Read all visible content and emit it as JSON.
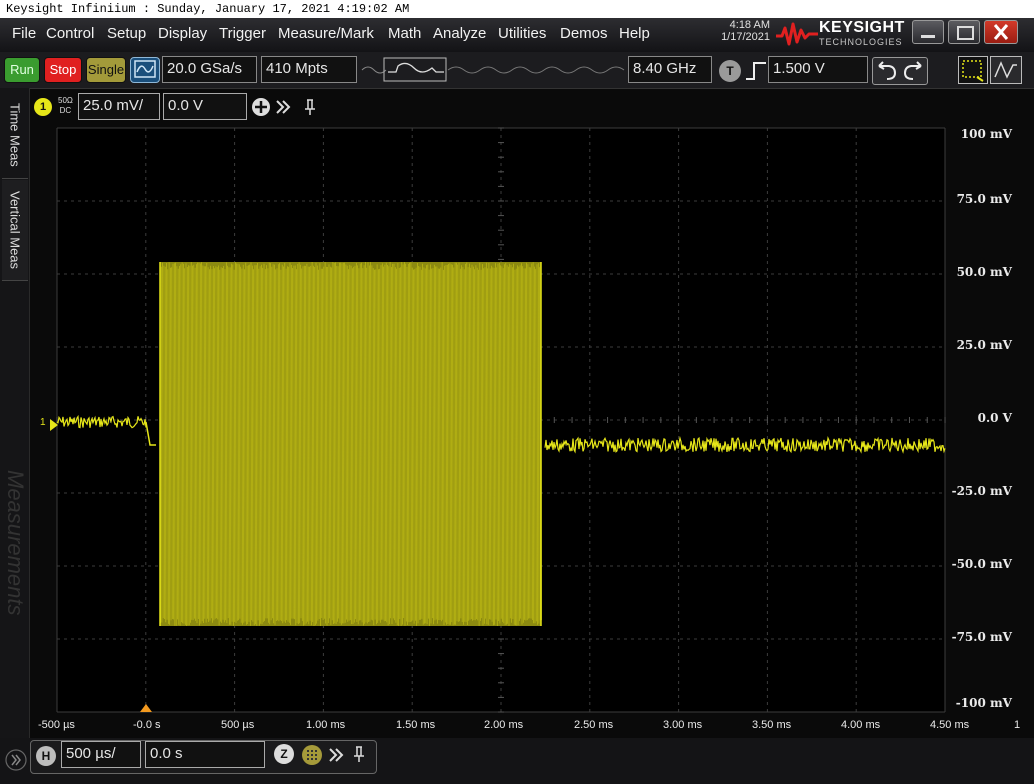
{
  "window": {
    "title": "Keysight Infiniium : Sunday, January 17, 2021 4:19:02 AM",
    "clock_time": "4:18 AM",
    "clock_date": "1/17/2021",
    "brand_name": "KEYSIGHT",
    "brand_sub": "TECHNOLOGIES"
  },
  "menu": [
    "File",
    "Control",
    "Setup",
    "Display",
    "Trigger",
    "Measure/Mark",
    "Math",
    "Analyze",
    "Utilities",
    "Demos",
    "Help"
  ],
  "toolbar": {
    "run_label": "Run",
    "stop_label": "Stop",
    "single_label": "Single",
    "sample_rate": "20.0 GSa/s",
    "memory_depth": "410 Mpts",
    "bandwidth": "8.40 GHz",
    "trigger_icon_label": "T",
    "trigger_level": "1.500 V"
  },
  "left_tabs": [
    "Time Meas",
    "Vertical Meas",
    "Measurements"
  ],
  "channel": {
    "number": "1",
    "impedance": "50Ω",
    "coupling": "DC",
    "scale": "25.0 mV/",
    "offset": "0.0 V"
  },
  "axis": {
    "y_labels": [
      "100 mV",
      "75.0 mV",
      "50.0 mV",
      "25.0 mV",
      "0.0 V",
      "-25.0 mV",
      "-50.0 mV",
      "-75.0 mV",
      "-100 mV"
    ],
    "x_labels": [
      "-500 µs",
      "-0.0 s",
      "500 µs",
      "1.00 ms",
      "1.50 ms",
      "2.00 ms",
      "2.50 ms",
      "3.00 ms",
      "3.50 ms",
      "4.00 ms",
      "4.50 ms"
    ],
    "edge_label": "1",
    "ground_marker": "1"
  },
  "horizontal": {
    "label": "H",
    "scale": "500 µs/",
    "position": "0.0 s",
    "zoom_label": "Z"
  },
  "colors": {
    "trace": "#e6e619",
    "grid": "#3c3c3c",
    "run": "#3a9c2f",
    "stop": "#e02020",
    "single": "#a39a3a",
    "trigger_marker": "#f39a1f"
  }
}
